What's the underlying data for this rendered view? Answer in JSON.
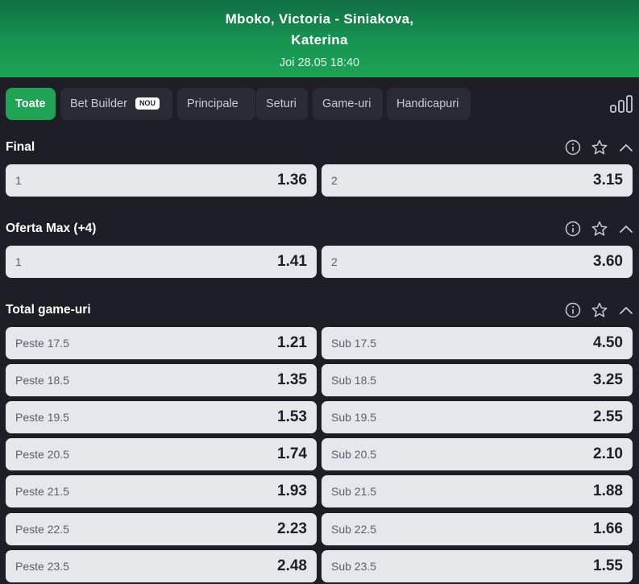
{
  "header": {
    "match_line1": "Mboko, Victoria - Siniakova,",
    "match_line2": "Katerina",
    "date": "Joi 28.05 18:40"
  },
  "tabs": [
    {
      "label": "Toate",
      "active": true
    },
    {
      "label": "Bet Builder",
      "badge": "NOU"
    },
    {
      "label": "Principale"
    },
    {
      "label": "Seturi"
    },
    {
      "label": "Game-uri"
    },
    {
      "label": "Handicapuri"
    }
  ],
  "icons": {
    "stats": "bar-chart-icon",
    "info": "info-icon",
    "favorite": "star-icon",
    "collapse": "chevron-up-icon"
  },
  "colors": {
    "brand_green": "#1fa456",
    "odd_bg": "#e6e7eb",
    "page_bg": "#1e1f26"
  },
  "markets": [
    {
      "title": "Final",
      "rows": [
        {
          "left": {
            "label": "1",
            "odd": "1.36"
          },
          "right": {
            "label": "2",
            "odd": "3.15"
          }
        }
      ]
    },
    {
      "title": "Oferta Max (+4)",
      "rows": [
        {
          "left": {
            "label": "1",
            "odd": "1.41"
          },
          "right": {
            "label": "2",
            "odd": "3.60"
          }
        }
      ]
    },
    {
      "title": "Total game-uri",
      "rows": [
        {
          "left": {
            "label": "Peste 17.5",
            "odd": "1.21"
          },
          "right": {
            "label": "Sub 17.5",
            "odd": "4.50"
          }
        },
        {
          "left": {
            "label": "Peste 18.5",
            "odd": "1.35"
          },
          "right": {
            "label": "Sub 18.5",
            "odd": "3.25"
          }
        },
        {
          "left": {
            "label": "Peste 19.5",
            "odd": "1.53"
          },
          "right": {
            "label": "Sub 19.5",
            "odd": "2.55"
          }
        },
        {
          "left": {
            "label": "Peste 20.5",
            "odd": "1.74"
          },
          "right": {
            "label": "Sub 20.5",
            "odd": "2.10"
          }
        },
        {
          "left": {
            "label": "Peste 21.5",
            "odd": "1.93"
          },
          "right": {
            "label": "Sub 21.5",
            "odd": "1.88"
          }
        },
        {
          "left": {
            "label": "Peste 22.5",
            "odd": "2.23"
          },
          "right": {
            "label": "Sub 22.5",
            "odd": "1.66"
          }
        },
        {
          "left": {
            "label": "Peste 23.5",
            "odd": "2.48"
          },
          "right": {
            "label": "Sub 23.5",
            "odd": "1.55"
          }
        }
      ]
    }
  ]
}
